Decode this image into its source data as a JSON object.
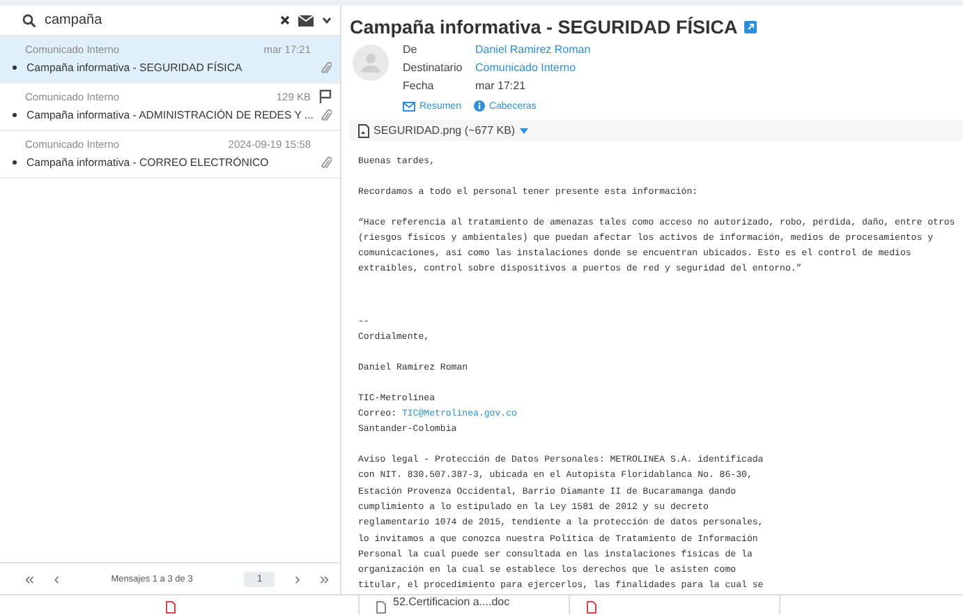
{
  "search": {
    "value": "campaña"
  },
  "messages": [
    {
      "sender": "Comunicado Interno",
      "meta": "mar 17:21",
      "subject": "Campaña informativa - SEGURIDAD FÍSICA",
      "selected": true,
      "attachment": true,
      "flag": false
    },
    {
      "sender": "Comunicado Interno",
      "meta": "129 KB",
      "subject": "Campaña informativa - ADMINISTRACIÓN DE REDES Y ...",
      "selected": false,
      "attachment": true,
      "flag": true
    },
    {
      "sender": "Comunicado Interno",
      "meta": "2024-09-19 15:58",
      "subject": "Campaña informativa - CORREO ELECTRÓNICO",
      "selected": false,
      "attachment": true,
      "flag": false
    }
  ],
  "pager": {
    "first": "«",
    "prev": "‹",
    "info": "Mensajes 1 a 3 de 3",
    "page": "1",
    "next": "›",
    "last": "»"
  },
  "message": {
    "title": "Campaña informativa - SEGURIDAD FÍSICA",
    "headers": [
      {
        "label": "De",
        "value": "Daniel Ramirez Roman",
        "link": true
      },
      {
        "label": "Destinatario",
        "value": "Comunicado Interno",
        "link": true
      },
      {
        "label": "Fecha",
        "value": "mar 17:21",
        "link": false
      }
    ],
    "links": [
      "Resumen",
      "Cabeceras"
    ],
    "attachment": "SEGURIDAD.png (~677 KB)",
    "body": [
      {
        "kind": "text",
        "text": "Buenas tardes,"
      },
      {
        "kind": "text",
        "text": "Recordamos a todo el personal tener presente esta información:"
      },
      {
        "kind": "text",
        "text": "“Hace referencia al tratamiento de amenazas tales como acceso no autorizado, robo, pérdida, daño, entre otros\n(riesgos físicos y ambientales) que puedan afectar los activos de información, medios de procesamientos y\ncomunicaciones, así como las instalaciones donde se encuentran ubicados. Esto es el control de medios\nextraíbles, control sobre dispositivos a puertos de red y seguridad del entorno.”"
      },
      {
        "kind": "gap"
      },
      {
        "kind": "text",
        "text": "--\nCordialmente,"
      },
      {
        "kind": "text",
        "text": "Daniel Ramirez Roman"
      },
      {
        "kind": "text",
        "text": "TIC-Metrolínea"
      },
      {
        "kind": "contact",
        "label": "Correo: ",
        "link": "TIC@Metrolinea.gov.co",
        "after": "Santander-Colombia"
      },
      {
        "kind": "text",
        "text": "Aviso legal - Protección de Datos Personales: METROLINEA S.A. identificada\ncon NIT. 830.507.387-3, ubicada en el Autopista Floridablanca No. 86-30,\nEstación Provenza Occidental, Barrio Diamante II de Bucaramanga dando\ncumplimiento a lo estipulado en la Ley 1581 de 2012 y su decreto\nreglamentario 1074 de 2015, tendiente a la protección de datos personales,\nlo invitamos a que conozca nuestra Política de Tratamiento de Información\nPersonal la cual puede ser consultada en las instalaciones físicas de la\norganización en la cual se establece los derechos que le asisten como\ntitular, el procedimiento para ejercerlos, las finalidades para la cual se"
      }
    ]
  },
  "downloads": [
    {
      "kind": "blank"
    },
    {
      "kind": "file",
      "name": "52.Certificacion a....doc"
    },
    {
      "kind": "blank"
    }
  ]
}
